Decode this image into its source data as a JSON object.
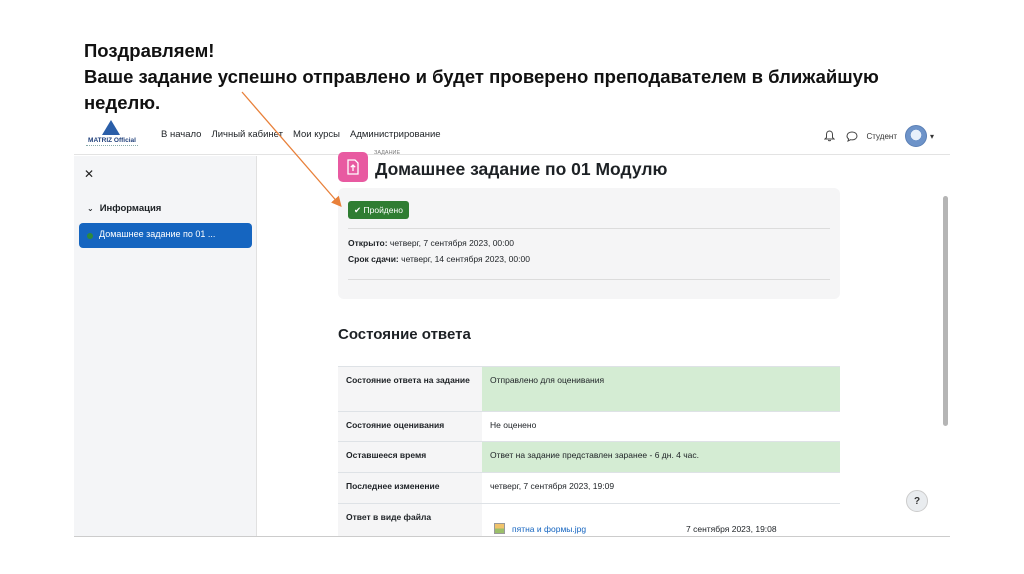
{
  "slide": {
    "line1": "Поздравляем!",
    "line2": "Ваше задание успешно отправлено и будет проверено преподавателем в ближайшую",
    "line3": "неделю."
  },
  "navbar": {
    "logo_text": "MATRIZ Official",
    "links": [
      "В начало",
      "Личный кабинет",
      "Мои курсы",
      "Администрирование"
    ],
    "user_label": "Студент",
    "icons": [
      "bell-icon",
      "chat-icon"
    ]
  },
  "drawer": {
    "section": "Информация",
    "item": "Домашнее задание по 01 ..."
  },
  "page": {
    "activity_kind": "ЗАДАНИЕ",
    "title": "Домашнее задание по 01 Модулю",
    "status_pill": "Пройдено",
    "opened_label": "Открыто:",
    "opened_value": " четверг, 7 сентября 2023, 00:00",
    "due_label": "Срок сдачи:",
    "due_value": " четверг, 14 сентября 2023, 00:00"
  },
  "submission": {
    "heading": "Состояние ответа",
    "rows": [
      {
        "label": "Состояние ответа на задание",
        "value": "Отправлено для оценивания"
      },
      {
        "label": "Состояние оценивания",
        "value": "Не оценено"
      },
      {
        "label": "Оставшееся время",
        "value": "Ответ на задание представлен заранее - 6 дн. 4 час."
      },
      {
        "label": "Последнее изменение",
        "value": "четверг, 7 сентября 2023, 19:09"
      },
      {
        "label": "Ответ в виде файла",
        "value": ""
      }
    ],
    "file_name": "пятна и формы.jpg",
    "file_date": "7 сентября 2023, 19:08"
  },
  "help_label": "?",
  "colors": {
    "accent": "#1565c0",
    "success": "#2f7d32",
    "success_bg": "#d4ecd3",
    "activity_icon": "#e85aa1",
    "arrow": "#e8803a"
  }
}
